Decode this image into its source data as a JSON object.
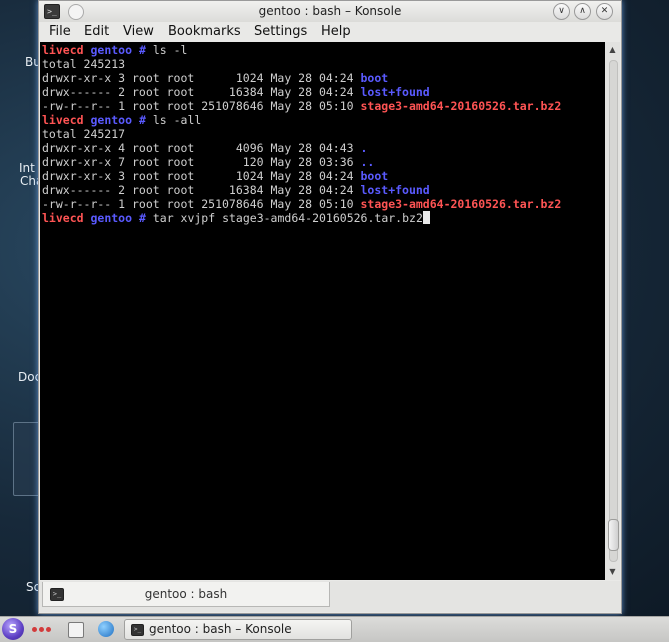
{
  "desktop": {
    "fragments": [
      "Bu",
      "Int",
      "Cha",
      "Doc",
      "Sc"
    ]
  },
  "window": {
    "title": "gentoo : bash – Konsole",
    "icon": "terminal-icon",
    "buttons": {
      "minimize": "∨",
      "maximize": "∧",
      "close": "✕"
    }
  },
  "menu": [
    "File",
    "Edit",
    "View",
    "Bookmarks",
    "Settings",
    "Help"
  ],
  "terminal": {
    "colors": {
      "prompt_user": "#ff5454",
      "prompt_host": "#5a5aff",
      "text": "#cfcfcf",
      "background": "#000000"
    },
    "lines": [
      {
        "type": "prompt",
        "user": "livecd",
        "host": "gentoo",
        "sym": "#",
        "cmd": "ls -l"
      },
      {
        "type": "text",
        "text": "total 245213"
      },
      {
        "type": "entry",
        "meta": "drwxr-xr-x 3 root root      1024 May 28 04:24 ",
        "name": "boot",
        "color": "blue"
      },
      {
        "type": "entry",
        "meta": "drwx------ 2 root root     16384 May 28 04:24 ",
        "name": "lost+found",
        "color": "blue"
      },
      {
        "type": "entry",
        "meta": "-rw-r--r-- 1 root root 251078646 May 28 05:10 ",
        "name": "stage3-amd64-20160526.tar.bz2",
        "color": "red"
      },
      {
        "type": "prompt",
        "user": "livecd",
        "host": "gentoo",
        "sym": "#",
        "cmd": "ls -all"
      },
      {
        "type": "text",
        "text": "total 245217"
      },
      {
        "type": "entry",
        "meta": "drwxr-xr-x 4 root root      4096 May 28 04:43 ",
        "name": ".",
        "color": "blue"
      },
      {
        "type": "entry",
        "meta": "drwxr-xr-x 7 root root       120 May 28 03:36 ",
        "name": "..",
        "color": "blue"
      },
      {
        "type": "entry",
        "meta": "drwxr-xr-x 3 root root      1024 May 28 04:24 ",
        "name": "boot",
        "color": "blue"
      },
      {
        "type": "entry",
        "meta": "drwx------ 2 root root     16384 May 28 04:24 ",
        "name": "lost+found",
        "color": "blue"
      },
      {
        "type": "entry",
        "meta": "-rw-r--r-- 1 root root 251078646 May 28 05:10 ",
        "name": "stage3-amd64-20160526.tar.bz2",
        "color": "red"
      },
      {
        "type": "prompt",
        "user": "livecd",
        "host": "gentoo",
        "sym": "#",
        "cmd": "tar xvjpf stage3-amd64-20160526.tar.bz2",
        "cursor": true
      }
    ]
  },
  "tab": {
    "label": "gentoo : bash"
  },
  "taskbar": {
    "task_label": "gentoo : bash – Konsole"
  }
}
